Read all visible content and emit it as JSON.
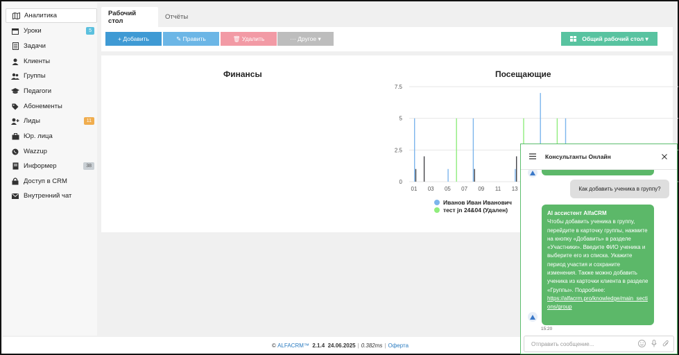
{
  "sidebar": {
    "items": [
      {
        "label": "Аналитика",
        "icon": "map-icon",
        "active": true
      },
      {
        "label": "Уроки",
        "icon": "calendar-icon",
        "badge": "5",
        "badge_color": "#5bc0de"
      },
      {
        "label": "Задачи",
        "icon": "tasks-icon"
      },
      {
        "label": "Клиенты",
        "icon": "user-icon"
      },
      {
        "label": "Группы",
        "icon": "users-icon"
      },
      {
        "label": "Педагоги",
        "icon": "graduation-cap-icon"
      },
      {
        "label": "Абонементы",
        "icon": "tag-icon"
      },
      {
        "label": "Лиды",
        "icon": "user-plus-icon",
        "badge": "11",
        "badge_color": "#f0ad4e"
      },
      {
        "label": "Юр. лица",
        "icon": "briefcase-icon"
      },
      {
        "label": "Wazzup",
        "icon": "whatsapp-icon"
      },
      {
        "label": "Информер",
        "icon": "book-icon",
        "badge": "38",
        "badge_color": "#c9cfd4"
      },
      {
        "label": "Доступ в CRM",
        "icon": "lock-icon"
      },
      {
        "label": "Внутренний чат",
        "icon": "envelope-icon"
      }
    ]
  },
  "tabs": {
    "desktop": "Рабочий стол",
    "reports": "Отчёты"
  },
  "toolbar": {
    "add": "+ Добавить",
    "edit": "✎ Править",
    "delete": "🗑 Удалить",
    "other": "··· Другое ▾",
    "shared_desktop": "Общий рабочий стол ▾"
  },
  "cards": {
    "finance_title": "Финансы",
    "visitors_title": "Посещающие"
  },
  "chart_data": {
    "type": "bar",
    "title": "Посещающие",
    "x_tick_labels": [
      "01",
      "03",
      "05",
      "07",
      "09",
      "11",
      "13"
    ],
    "y_ticks": [
      "0",
      "2.5",
      "5",
      "7.5"
    ],
    "ylim": [
      0,
      7.5
    ],
    "series": [
      {
        "name": "Иванов Иван Иванович",
        "color": "#7cb5ec",
        "points": [
          [
            1,
            5
          ],
          [
            5,
            1
          ],
          [
            8,
            5
          ],
          [
            13,
            1
          ],
          [
            16,
            7
          ],
          [
            19,
            5
          ]
        ]
      },
      {
        "name": "тест jn 24&04 (Удален)",
        "color": "#90ed7d",
        "points": [
          [
            6,
            5
          ],
          [
            14,
            5
          ],
          [
            18,
            5
          ]
        ]
      },
      {
        "name": "",
        "color": "#434348",
        "points": [
          [
            1,
            1
          ],
          [
            2,
            2
          ],
          [
            8,
            1
          ],
          [
            13,
            2
          ]
        ]
      }
    ]
  },
  "footer": {
    "copyright": "©",
    "brand": "ALFACRM™",
    "version": "2.1.4",
    "date": "24.06.2025",
    "sep": "|",
    "timing": "0.382ms",
    "offer": "Оферта"
  },
  "chat": {
    "title": "Консультанты Онлайн",
    "user_message": "Как добавить ученика в группу?",
    "bot_name": "AI ассистент AlfaCRM",
    "bot_message": "Чтобы добавить ученика в группу, перейдите в карточку группы, нажмите на кнопку «Добавить» в разделе «Участники». Введите ФИО ученика и выберите его из списка. Укажите период участия и сохраните изменения. Также можно добавить ученика из карточки клиента в разделе «Группы». Подробнее:",
    "bot_link": "https://alfacrm.pro/knowledge/main_sections/group",
    "time": "15:20",
    "input_placeholder": "Отправить сообщение..."
  }
}
